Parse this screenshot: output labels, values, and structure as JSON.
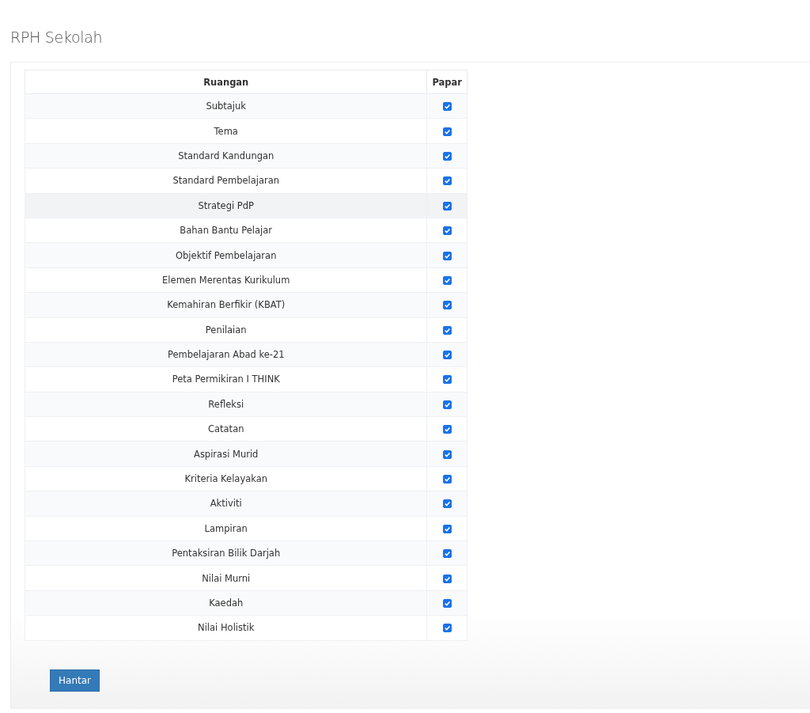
{
  "page_title": "RPH Sekolah",
  "table": {
    "columns": [
      "Ruangan",
      "Papar"
    ],
    "rows": [
      {
        "label": "Subtajuk",
        "checked": true,
        "highlighted": false
      },
      {
        "label": "Tema",
        "checked": true,
        "highlighted": false
      },
      {
        "label": "Standard Kandungan",
        "checked": true,
        "highlighted": false
      },
      {
        "label": "Standard Pembelajaran",
        "checked": true,
        "highlighted": false
      },
      {
        "label": "Strategi PdP",
        "checked": true,
        "highlighted": true
      },
      {
        "label": "Bahan Bantu Pelajar",
        "checked": true,
        "highlighted": false
      },
      {
        "label": "Objektif Pembelajaran",
        "checked": true,
        "highlighted": false
      },
      {
        "label": "Elemen Merentas Kurikulum",
        "checked": true,
        "highlighted": false
      },
      {
        "label": "Kemahiran Berfikir (KBAT)",
        "checked": true,
        "highlighted": false
      },
      {
        "label": "Penilaian",
        "checked": true,
        "highlighted": false
      },
      {
        "label": "Pembelajaran Abad ke-21",
        "checked": true,
        "highlighted": false
      },
      {
        "label": "Peta Permikiran I THINK",
        "checked": true,
        "highlighted": false
      },
      {
        "label": "Refleksi",
        "checked": true,
        "highlighted": false
      },
      {
        "label": "Catatan",
        "checked": true,
        "highlighted": false
      },
      {
        "label": "Aspirasi Murid",
        "checked": true,
        "highlighted": false
      },
      {
        "label": "Kriteria Kelayakan",
        "checked": true,
        "highlighted": false
      },
      {
        "label": "Aktiviti",
        "checked": true,
        "highlighted": false
      },
      {
        "label": "Lampiran",
        "checked": true,
        "highlighted": false
      },
      {
        "label": "Pentaksiran Bilik Darjah",
        "checked": true,
        "highlighted": false
      },
      {
        "label": "Nilai Murni",
        "checked": true,
        "highlighted": false
      },
      {
        "label": "Kaedah",
        "checked": true,
        "highlighted": false
      },
      {
        "label": "Nilai Holistik",
        "checked": true,
        "highlighted": false
      }
    ]
  },
  "submit_button": "Hantar"
}
